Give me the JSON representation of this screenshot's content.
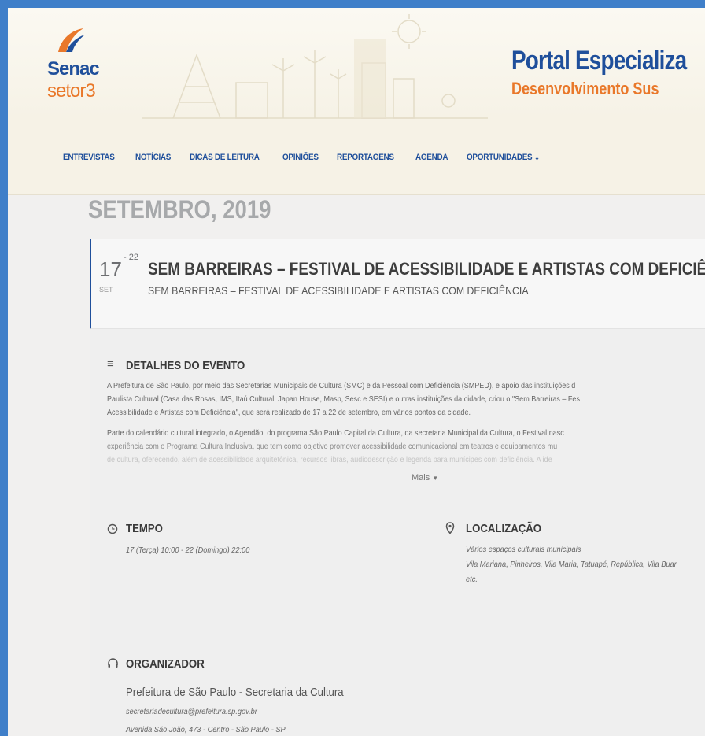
{
  "brand": {
    "line1": "Senac",
    "line2": "setor3",
    "portal_title": "Portal Especializa",
    "portal_subtitle": "Desenvolvimento Sus"
  },
  "nav": {
    "items": [
      "ENTREVISTAS",
      "NOTÍCIAS",
      "DICAS DE LEITURA",
      "OPINIÕES",
      "REPORTAGENS",
      "AGENDA",
      "OPORTUNIDADES"
    ],
    "dropdown_icon": "chevron-down-icon"
  },
  "month_heading": "SETEMBRO, 2019",
  "event": {
    "day_start": "17",
    "day_end": "- 22",
    "month_abbr": "SET",
    "title": "SEM BARREIRAS – FESTIVAL DE ACESSIBILIDADE E ARTISTAS COM DEFICIÊNCIA",
    "subtitle": "SEM BARREIRAS – FESTIVAL DE ACESSIBILIDADE E ARTISTAS COM DEFICIÊNCIA"
  },
  "details": {
    "heading": "DETALHES DO EVENTO",
    "para1": [
      "A Prefeitura de São Paulo, por meio das Secretarias Municipais de Cultura (SMC) e da Pessoal com Deficiência (SMPED), e apoio das instituições d",
      "Paulista Cultural (Casa das Rosas, IMS, Itaú Cultural, Japan House, Masp, Sesc e SESI) e outras instituições da cidade, criou o \"Sem Barreiras – Fes",
      "Acessibilidade e Artistas com Deficiência\", que será realizado de 17 a 22 de setembro, em vários pontos da cidade."
    ],
    "para2": [
      "Parte do calendário cultural integrado, o Agendão, do programa São Paulo Capital da Cultura, da secretaria Municipal da Cultura, o Festival nasc",
      "experiência com o Programa Cultura Inclusiva, que tem como objetivo promover acessibilidade comunicacional em teatros e equipamentos mu",
      "de cultura, oferecendo, além de acessibilidade arquitetônica, recursos libras, audiodescrição e legenda para munícipes com deficiência. A ide"
    ],
    "more_label": "Mais"
  },
  "time": {
    "heading": "TEMPO",
    "value": "17 (Terça) 10:00 - 22 (Domingo) 22:00"
  },
  "location": {
    "heading": "LOCALIZAÇÃO",
    "name": "Vários espaços culturais municipais",
    "line2": "Vila Mariana, Pinheiros, Vila Maria, Tatuapé, República, Vila Buar",
    "line3": "etc."
  },
  "organizer": {
    "heading": "ORGANIZADOR",
    "name": "Prefeitura de São Paulo - Secretaria da Cultura",
    "email": "secretariadecultura@prefeitura.sp.gov.br",
    "address": "Avenida São João, 473 - Centro - São Paulo - SP"
  },
  "colors": {
    "frame_border": "#3f7fc9",
    "brand_blue": "#1f4f9b",
    "brand_orange": "#e9782a"
  }
}
